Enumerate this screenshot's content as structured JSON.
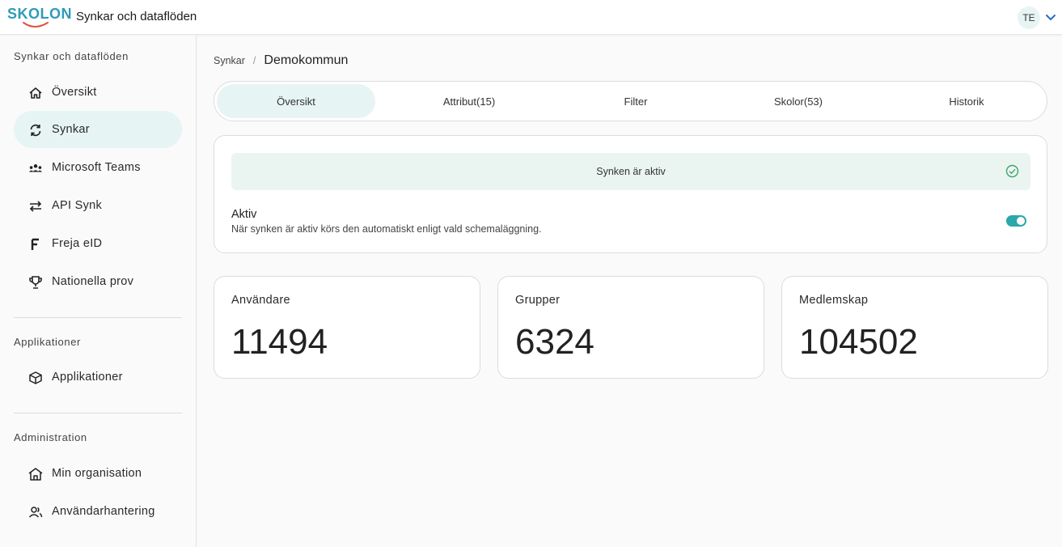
{
  "header": {
    "logo_text": "SKOLON",
    "app_title": "Synkar och dataflöden",
    "avatar_initials": "TE"
  },
  "sidebar": {
    "sections": [
      {
        "title": "Synkar och dataflöden"
      },
      {
        "title": "Applikationer"
      },
      {
        "title": "Administration"
      }
    ],
    "items": [
      {
        "label": "Översikt",
        "icon": "home-icon"
      },
      {
        "label": "Synkar",
        "icon": "sync-icon",
        "active": true
      },
      {
        "label": "Microsoft Teams",
        "icon": "teams-icon"
      },
      {
        "label": "API Synk",
        "icon": "swap-arrows-icon"
      },
      {
        "label": "Freja eID",
        "icon": "freja-icon"
      },
      {
        "label": "Nationella prov",
        "icon": "trophy-icon"
      },
      {
        "label": "Applikationer",
        "icon": "cube-icon"
      },
      {
        "label": "Min organisation",
        "icon": "organization-icon"
      },
      {
        "label": "Användarhantering",
        "icon": "users-icon"
      }
    ]
  },
  "breadcrumb": {
    "parent": "Synkar",
    "separator": "/",
    "current": "Demokommun"
  },
  "tabs": [
    {
      "label": "Översikt",
      "active": true
    },
    {
      "label": "Attribut(15)"
    },
    {
      "label": "Filter"
    },
    {
      "label": "Skolor(53)"
    },
    {
      "label": "Historik"
    }
  ],
  "status": {
    "message": "Synken är aktiv",
    "active_label": "Aktiv",
    "active_description": "När synken är aktiv körs den automatiskt enligt vald schemaläggning.",
    "toggle_on": true
  },
  "stats": [
    {
      "label": "Användare",
      "value": "11494"
    },
    {
      "label": "Grupper",
      "value": "6324"
    },
    {
      "label": "Medlemskap",
      "value": "104502"
    }
  ],
  "colors": {
    "accent": "#2aa8ab",
    "active_bg": "#e6f4f4",
    "status_bg": "#eaf5f1",
    "check_green": "#3fa46a",
    "logo_red": "#e0533d"
  }
}
